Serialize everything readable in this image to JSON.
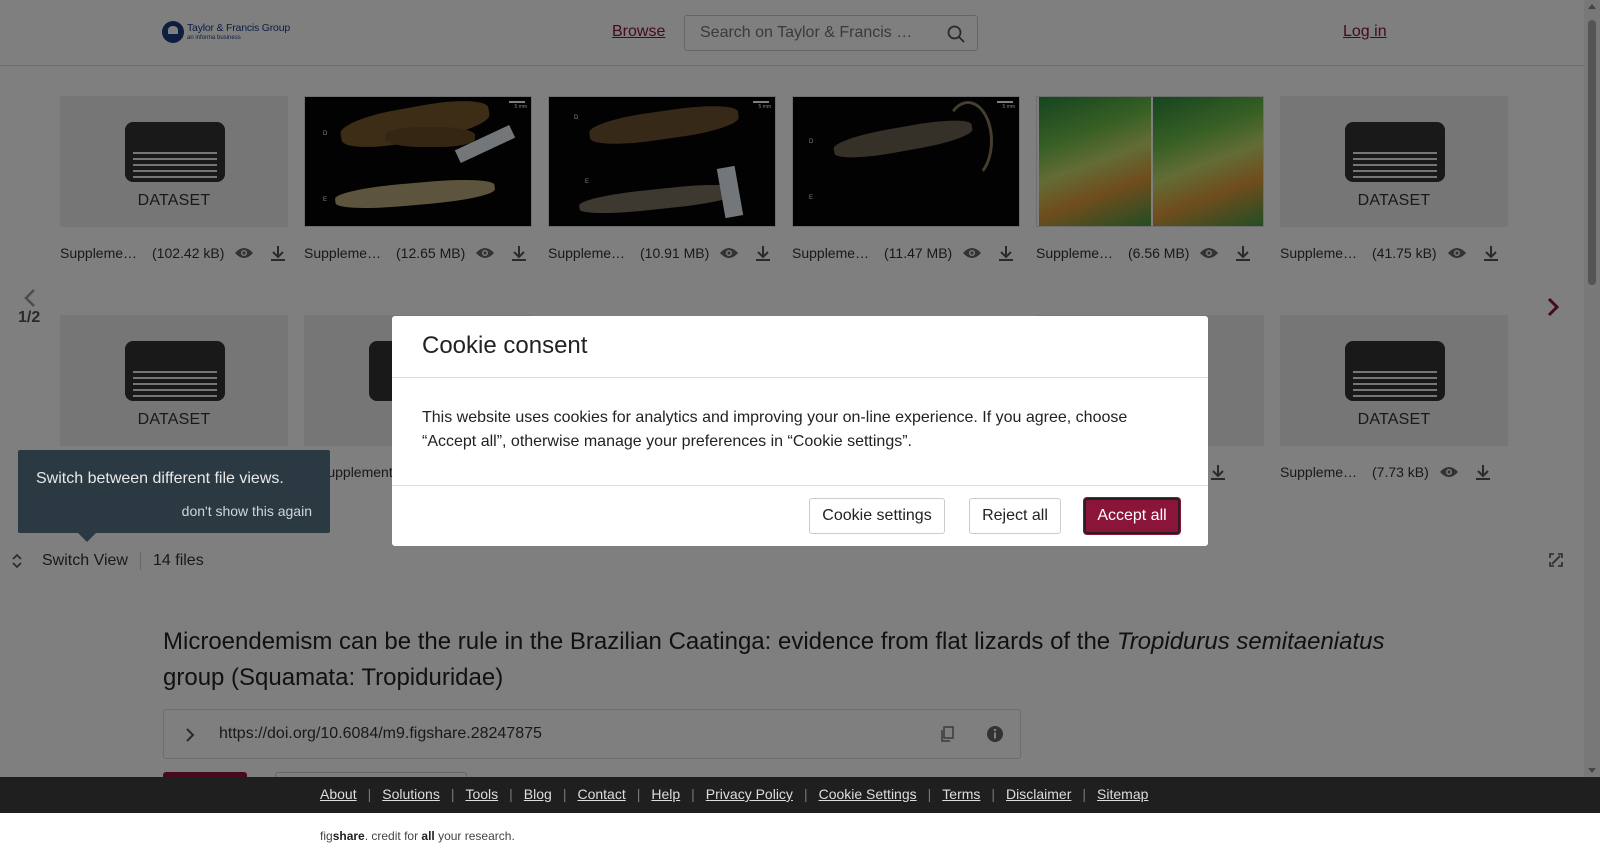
{
  "header": {
    "logo_line1": "Taylor & Francis Group",
    "logo_line2": "an informa business",
    "browse": "Browse",
    "search_placeholder": "Search on Taylor & Francis …",
    "login": "Log in"
  },
  "files": {
    "row1": [
      {
        "kind": "dataset",
        "label": "DATASET",
        "name": "Supplemental",
        "size": "(102.42 kB)"
      },
      {
        "kind": "image",
        "name": "Supplemental",
        "size": "(12.65 MB)"
      },
      {
        "kind": "image",
        "name": "Supplemental",
        "size": "(10.91 MB)"
      },
      {
        "kind": "image",
        "name": "Supplemental",
        "size": "(11.47 MB)"
      },
      {
        "kind": "map",
        "name": "Supplemental",
        "size": "(6.56 MB)"
      },
      {
        "kind": "dataset",
        "label": "DATASET",
        "name": "Supplemental",
        "size": "(41.75 kB)"
      }
    ],
    "row2": [
      {
        "kind": "dataset",
        "label": "DATASET"
      },
      {
        "kind": "partial",
        "name": "Supplemental"
      },
      {
        "kind": "hidden"
      },
      {
        "kind": "hidden"
      },
      {
        "kind": "partial"
      },
      {
        "kind": "dataset",
        "label": "DATASET",
        "name": "Supplemental",
        "size": "(7.73 kB)"
      }
    ],
    "scale_text": "5 mm",
    "photo_labels": [
      "D",
      "E"
    ],
    "pager": "1/2",
    "switch_view": "Switch View",
    "count": "14 files"
  },
  "tooltip": {
    "message": "Switch between different file views.",
    "dismiss": "don't show this again"
  },
  "article": {
    "title_pre": "Microendemism can be the rule in the Brazilian Caatinga: evidence from flat lizards of the ",
    "title_italic": "Tropidurus semitaeniatus",
    "title_post": " group (Squamata: Tropiduridae)",
    "doi": "https://doi.org/10.6084/m9.figshare.28247875"
  },
  "modal": {
    "title": "Cookie consent",
    "body": "This website uses cookies for analytics and improving your on-line experience. If you agree, choose “Accept all”, otherwise manage your preferences in “Cookie settings”.",
    "settings": "Cookie settings",
    "reject": "Reject all",
    "accept": "Accept all"
  },
  "footer": {
    "links": [
      "About",
      "Solutions",
      "Tools",
      "Blog",
      "Contact",
      "Help",
      "Privacy Policy",
      "Cookie Settings",
      "Terms",
      "Disclaimer",
      "Sitemap"
    ],
    "credit_fig": "fig",
    "credit_share": "share",
    "credit_mid": ". credit for ",
    "credit_all": "all",
    "credit_end": " your research."
  },
  "colors": {
    "brand": "#8a1538",
    "footer_bg": "#1f1f1f",
    "tooltip_bg": "#2b3a42"
  }
}
